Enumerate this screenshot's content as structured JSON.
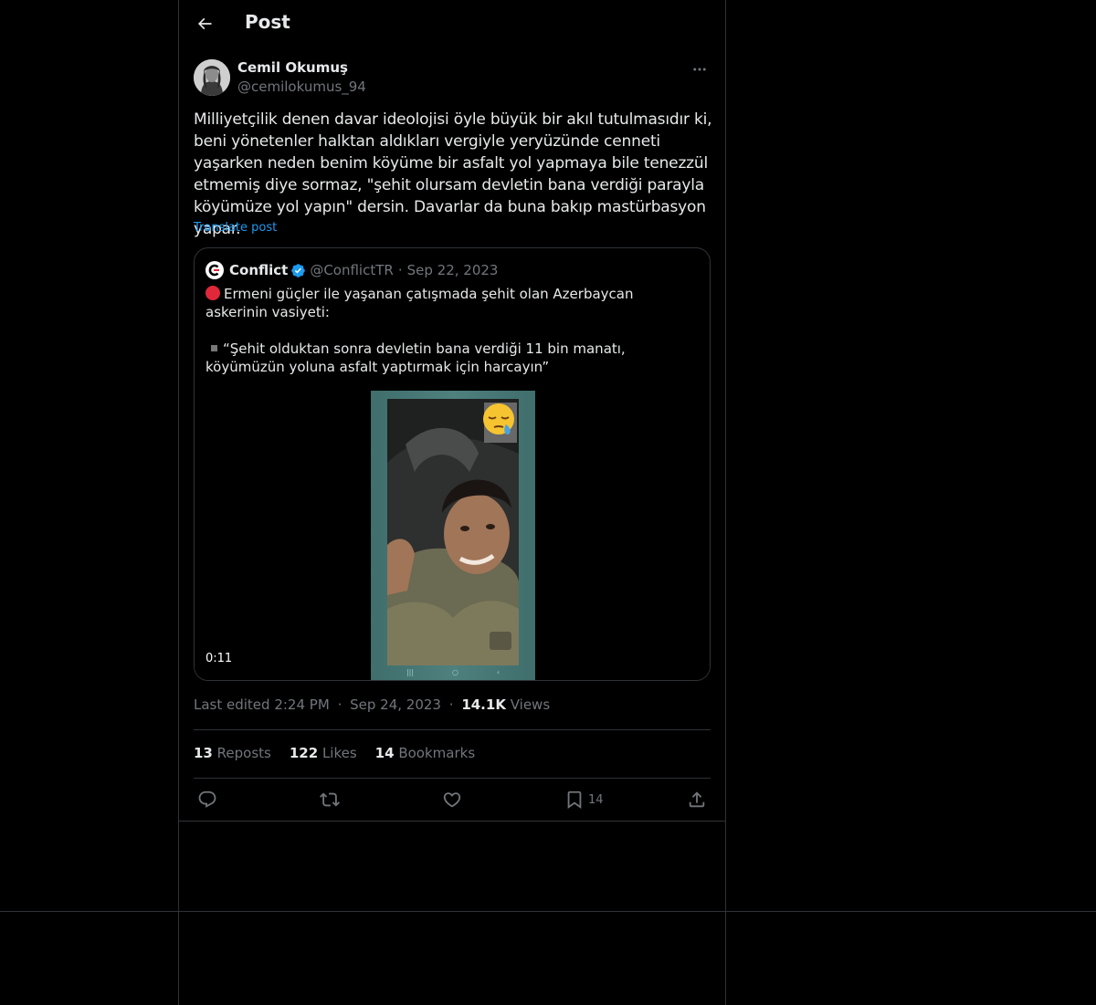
{
  "header": {
    "title": "Post"
  },
  "author": {
    "name": "Cemil Okumuş",
    "handle": "@cemilokumus_94"
  },
  "tweet": {
    "text": "Milliyetçilik denen davar ideolojisi öyle büyük bir akıl tutulmasıdır ki, beni yönetenler halktan aldıkları vergiyle yeryüzünde cenneti yaşarken neden benim köyüme bir asfalt yol yapmaya bile tenezzül etmemiş diye sormaz, \"şehit olursam devletin bana verdiği parayla köyümüze yol yapın\" dersin. Davarlar da buna bakıp mastürbasyon yapar.",
    "translate_label": "Translate post"
  },
  "quote": {
    "name": "Conflict",
    "handle": "@ConflictTR",
    "separator": "·",
    "date": "Sep 22, 2023",
    "line1": "Ermeni güçler ile yaşanan çatışmada şehit olan Azerbaycan askerinin vasiyeti:",
    "line2": "“Şehit olduktan sonra devletin bana verdiği 11 bin manatı, köyümüzün yoluna asfalt yaptırmak için harcayın”",
    "video_duration": "0:11",
    "red_dot_color": "#e0283a"
  },
  "meta": {
    "edited": "Last edited 2:24 PM",
    "separator": "·",
    "date": "Sep 24, 2023",
    "views_count": "14.1K",
    "views_label": "Views"
  },
  "stats": {
    "reposts_count": "13",
    "reposts_label": "Reposts",
    "likes_count": "122",
    "likes_label": "Likes",
    "bookmarks_count": "14",
    "bookmarks_label": "Bookmarks"
  },
  "actions": {
    "bookmark_count": "14",
    "icons": [
      "reply-icon",
      "repost-icon",
      "like-icon",
      "bookmark-icon",
      "share-icon"
    ]
  },
  "colors": {
    "background": "#000000",
    "text": "#e7e9ea",
    "muted": "#71767b",
    "link": "#1d9bf0",
    "border": "#2f3336"
  }
}
